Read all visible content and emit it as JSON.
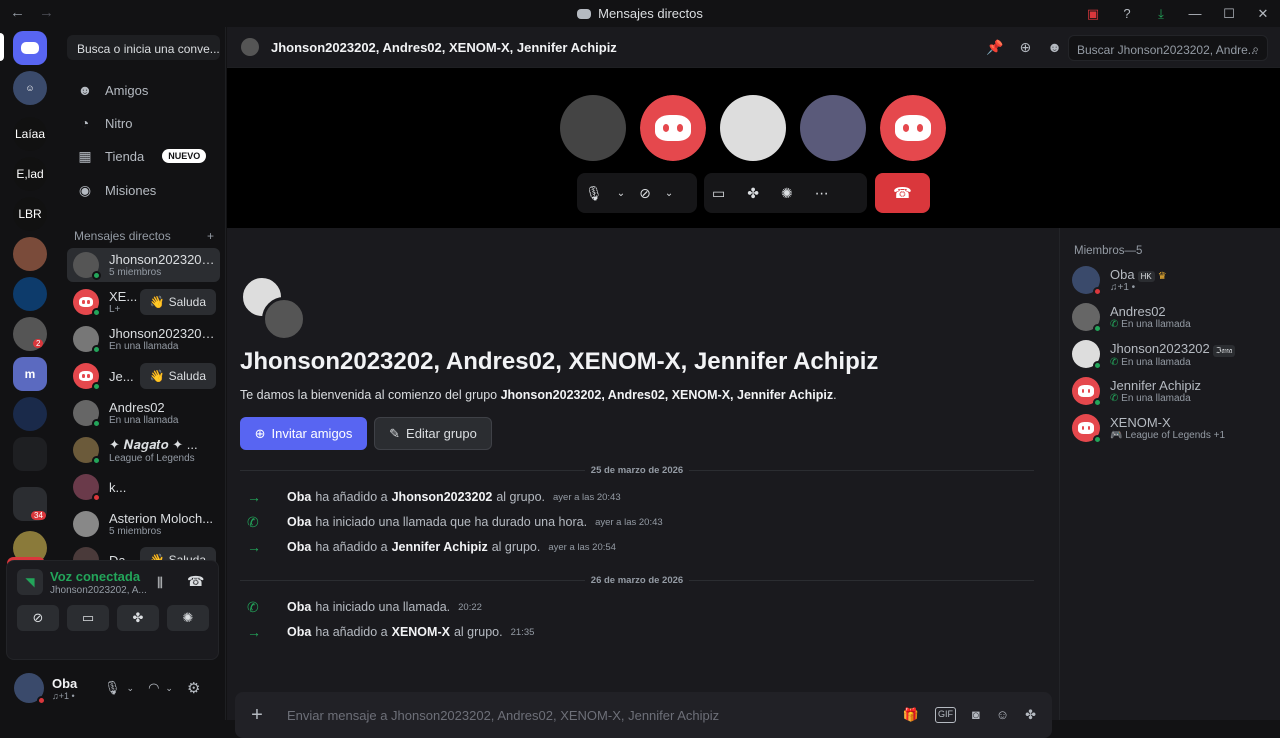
{
  "window": {
    "title": "Mensajes directos"
  },
  "guilds": [
    {
      "label": ""
    },
    {
      "label": ""
    },
    {
      "label": "Laíaa"
    },
    {
      "label": "E,lad"
    },
    {
      "label": "LBR"
    },
    {
      "label": ""
    },
    {
      "label": ""
    },
    {
      "label": "",
      "badge": "2"
    },
    {
      "label": ""
    },
    {
      "label": ""
    },
    {
      "label": ""
    },
    {
      "label": "",
      "badge": "34"
    },
    {
      "label": "",
      "badge": "NUEVO"
    }
  ],
  "dm_panel": {
    "search_placeholder": "Busca o inicia una conve...",
    "nav": [
      {
        "label": "Amigos",
        "icon": "friends-icon"
      },
      {
        "label": "Nitro",
        "icon": "nitro-icon"
      },
      {
        "label": "Tienda",
        "icon": "shop-icon",
        "badge": "NUEVO"
      },
      {
        "label": "Misiones",
        "icon": "quests-icon"
      }
    ],
    "dm_header": "Mensajes directos",
    "dms": [
      {
        "name": "Jhonson20232020...",
        "sub": "5 miembros",
        "selected": true
      },
      {
        "name": "XE...",
        "sub": "L+",
        "action": "Saluda"
      },
      {
        "name": "Jhonson20232020...",
        "sub": "En una llamada"
      },
      {
        "name": "Je...",
        "sub": "",
        "action": "Saluda"
      },
      {
        "name": "Andres02",
        "sub": "En una llamada"
      },
      {
        "name": "✦ 𝑵𝒂𝒈𝒂𝒕𝒐 ✦ ...",
        "sub": "League of Legends"
      },
      {
        "name": "k...",
        "sub": ""
      },
      {
        "name": "Asterion Moloch...",
        "sub": "5 miembros"
      },
      {
        "name": "Da...",
        "sub": "",
        "action": "Saluda"
      }
    ]
  },
  "voice": {
    "title": "Voz conectada",
    "sub": "Jhonson2023202, A..."
  },
  "user": {
    "name": "Oba",
    "status": "♫+1 •"
  },
  "header": {
    "name": "Jhonson2023202, Andres02, XENOM-X, Jennifer Achipiz",
    "search_placeholder": "Buscar Jhonson2023202, Andre..."
  },
  "chat": {
    "group_title": "Jhonson2023202, Andres02, XENOM-X, Jennifer Achipiz",
    "welcome_prefix": "Te damos la bienvenida al comienzo del grupo ",
    "welcome_group": "Jhonson2023202, Andres02, XENOM-X, Jennifer Achipiz",
    "welcome_suffix": ".",
    "invite_label": "Invitar amigos",
    "edit_label": "Editar grupo",
    "date1": "25 de marzo de 2026",
    "date2": "26 de marzo de 2026",
    "messages": [
      {
        "actor": "Oba",
        "pre": "ha añadido a",
        "target": "Jhonson2023202",
        "post": "al grupo.",
        "time": "ayer a las 20:43",
        "icon": "arrow-right-icon"
      },
      {
        "actor": "Oba",
        "pre": "ha iniciado una llamada que ha durado una hora.",
        "target": "",
        "post": "",
        "time": "ayer a las 20:43",
        "icon": "phone-icon"
      },
      {
        "actor": "Oba",
        "pre": "ha añadido a",
        "target": "Jennifer Achipiz",
        "post": "al grupo.",
        "time": "ayer a las 20:54",
        "icon": "arrow-right-icon"
      },
      {
        "actor": "Oba",
        "pre": "ha iniciado una llamada.",
        "target": "",
        "post": "",
        "time": "20:22",
        "icon": "phone-icon"
      },
      {
        "actor": "Oba",
        "pre": "ha añadido a",
        "target": "XENOM-X",
        "post": "al grupo.",
        "time": "21:35",
        "icon": "arrow-right-icon"
      }
    ],
    "composer_placeholder": "Enviar mensaje a Jhonson2023202, Andres02, XENOM-X, Jennifer Achipiz"
  },
  "members": {
    "header": "Miembros—5",
    "list": [
      {
        "name": "Oba",
        "tag": "HK",
        "sub": "♫+1 •"
      },
      {
        "name": "Andres02",
        "sub": "En una llamada"
      },
      {
        "name": "Jhonson2023202",
        "tag": "ℑ𝔞𝔫𝔞",
        "sub": "En una llamada"
      },
      {
        "name": "Jennifer Achipiz",
        "sub": "En una llamada"
      },
      {
        "name": "XENOM-X",
        "sub": "League of Legends +1"
      }
    ]
  },
  "colors": {
    "accent": "#5865f2",
    "danger": "#da373c",
    "online": "#23a55a"
  }
}
